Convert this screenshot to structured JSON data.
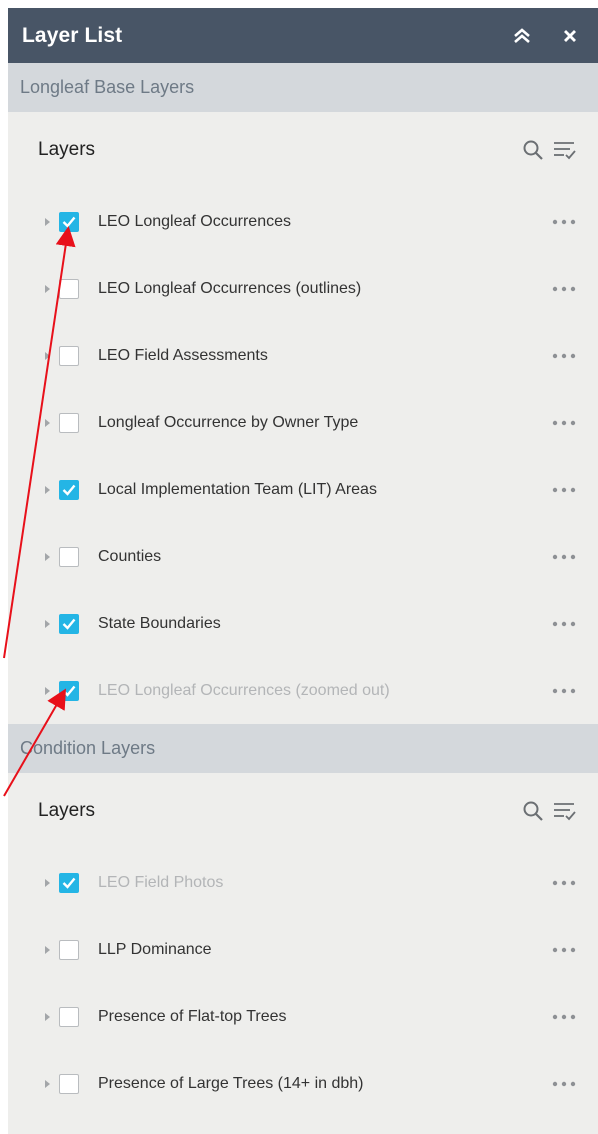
{
  "panel": {
    "title": "Layer List"
  },
  "groups": [
    {
      "header": "Longleaf Base Layers",
      "layers_title": "Layers",
      "items": [
        {
          "label": "LEO Longleaf Occurrences",
          "checked": true,
          "dim": false
        },
        {
          "label": "LEO Longleaf Occurrences (outlines)",
          "checked": false,
          "dim": false
        },
        {
          "label": "LEO Field Assessments",
          "checked": false,
          "dim": false
        },
        {
          "label": "Longleaf Occurrence by Owner Type",
          "checked": false,
          "dim": false
        },
        {
          "label": "Local Implementation Team (LIT) Areas",
          "checked": true,
          "dim": false
        },
        {
          "label": "Counties",
          "checked": false,
          "dim": false
        },
        {
          "label": "State Boundaries",
          "checked": true,
          "dim": false
        },
        {
          "label": "LEO Longleaf Occurrences (zoomed out)",
          "checked": true,
          "dim": true
        }
      ]
    },
    {
      "header": "Condition Layers",
      "layers_title": "Layers",
      "items": [
        {
          "label": "LEO Field Photos",
          "checked": true,
          "dim": true
        },
        {
          "label": "LLP Dominance",
          "checked": false,
          "dim": false
        },
        {
          "label": "Presence of Flat-top Trees",
          "checked": false,
          "dim": false
        },
        {
          "label": "Presence of Large Trees (14+ in dbh)",
          "checked": false,
          "dim": false
        }
      ]
    }
  ],
  "icons": {
    "collapse": "double-chevron-up-icon",
    "close": "close-icon",
    "search": "search-icon",
    "filter": "filter-list-icon",
    "expander": "caret-right-icon",
    "more": "more-dots-icon"
  },
  "colors": {
    "titlebar": "#485566",
    "group_header": "#d4d8dc",
    "panel_bg": "#eeeeec",
    "checkbox_checked": "#24b5e5",
    "annotation_arrow": "#e8101a"
  }
}
